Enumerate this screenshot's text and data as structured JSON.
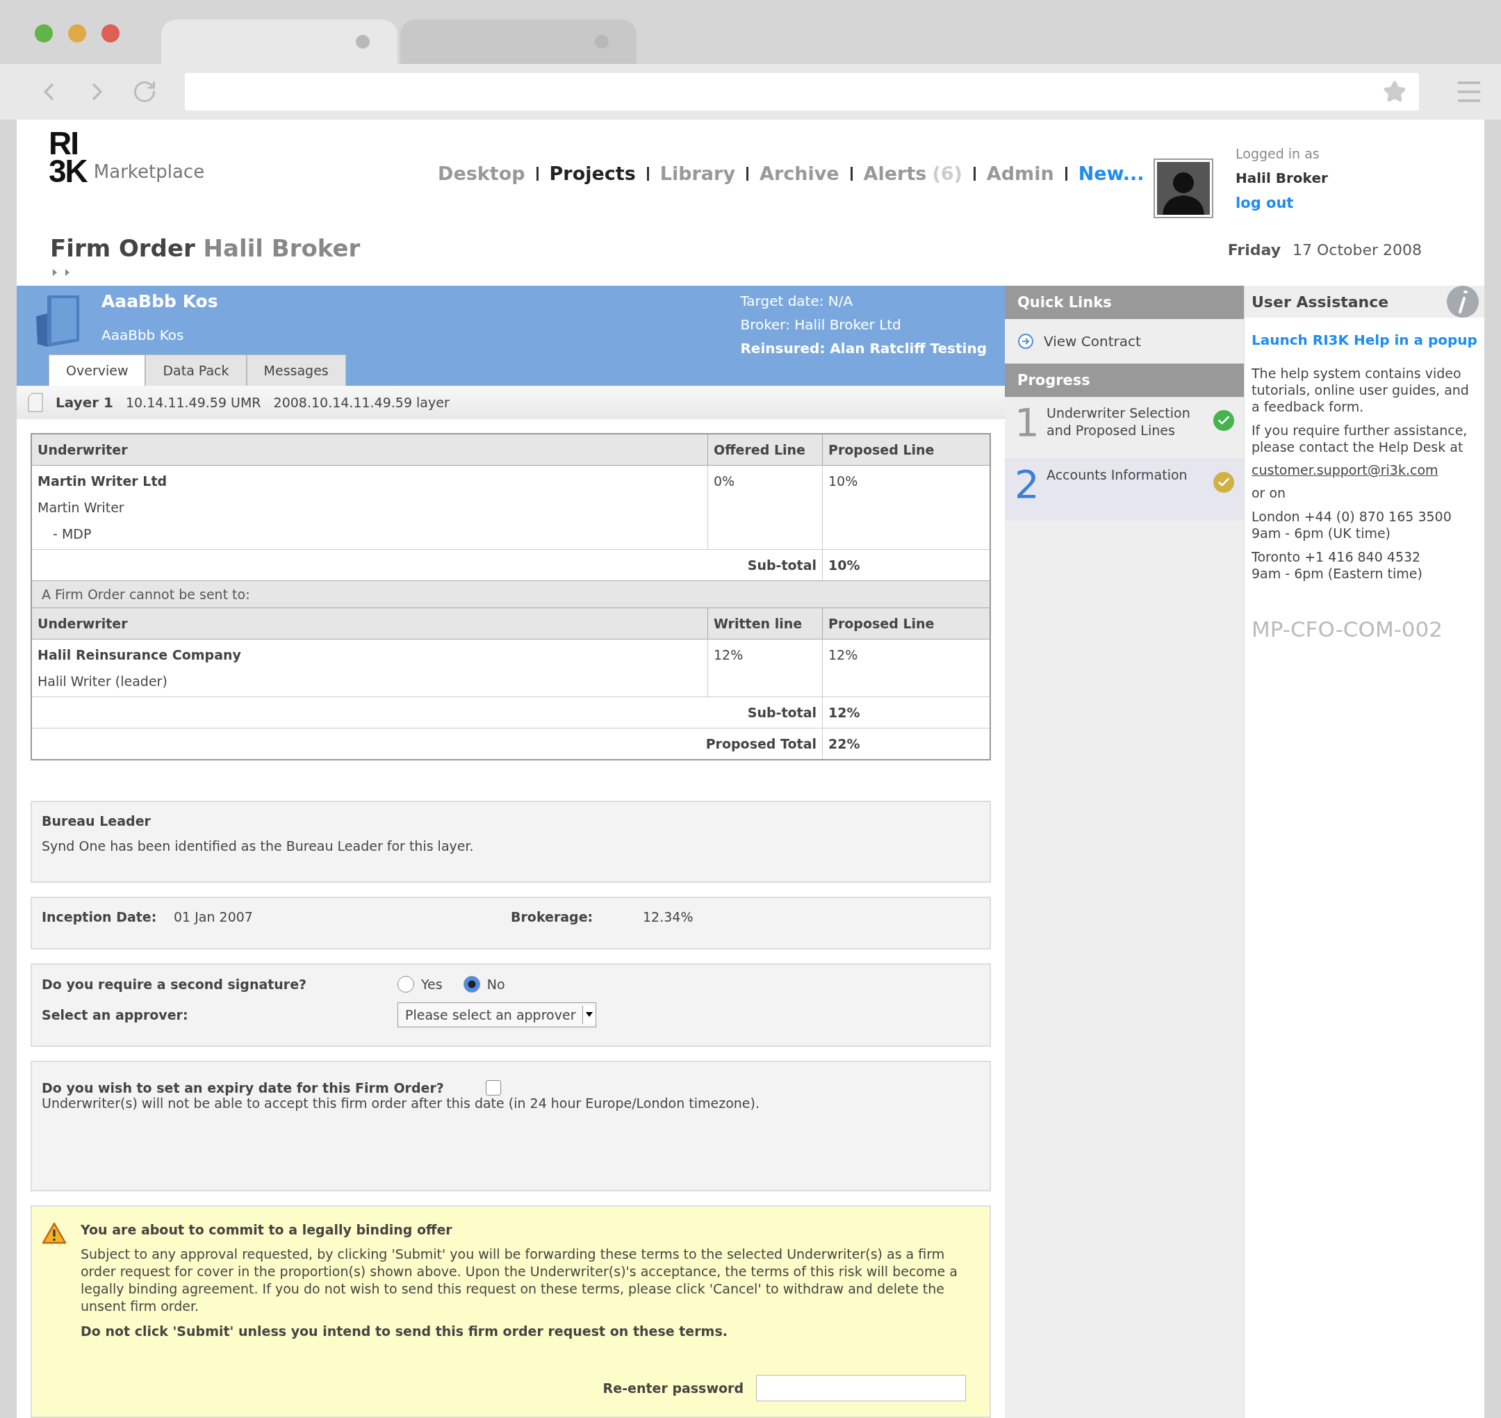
{
  "browser": {
    "tabs": [
      {
        "selected": true
      },
      {
        "selected": false
      }
    ]
  },
  "header": {
    "logo_top": "RI",
    "logo_bottom": "3K",
    "logo_sub": "Marketplace",
    "nav": [
      {
        "label": "Desktop",
        "kind": "link",
        "selected": false
      },
      {
        "label": "Projects",
        "kind": "link",
        "selected": true
      },
      {
        "label": "Library",
        "kind": "link",
        "selected": false
      },
      {
        "label": "Archive",
        "kind": "link",
        "selected": false
      },
      {
        "label": "Alerts",
        "count": "(6)",
        "kind": "link",
        "selected": false
      },
      {
        "label": "Admin",
        "kind": "link",
        "selected": false
      },
      {
        "label": "New...",
        "kind": "new",
        "selected": false
      }
    ],
    "user": {
      "caption": "Logged in as",
      "name": "Halil Broker",
      "logout": "log out"
    }
  },
  "page_title": {
    "main": "Firm Order",
    "sub": "Halil Broker"
  },
  "date": {
    "day": "Friday",
    "date": "17 October 2008"
  },
  "project": {
    "title": "AaaBbb Kos",
    "subtitle": "AaaBbb Kos",
    "meta": [
      "Target date: N/A",
      "Broker: Halil Broker Ltd"
    ],
    "reinsured": "Reinsured: Alan Ratcliff Testing",
    "tabs": [
      {
        "label": "Overview",
        "selected": true
      },
      {
        "label": "Data Pack",
        "selected": false
      },
      {
        "label": "Messages",
        "selected": false
      }
    ]
  },
  "layer": {
    "name": "Layer 1",
    "umr": "10.14.11.49.59 UMR",
    "ref": "2008.10.14.11.49.59 layer"
  },
  "table": {
    "columns": [
      "Underwriter",
      "Offered Line",
      "Proposed Line"
    ],
    "rows": [
      {
        "name": "Martin Writer Ltd",
        "lines": [
          "Martin Writer",
          "- MDP"
        ],
        "line": "0%",
        "proposed": "10%"
      }
    ],
    "subtotal": {
      "label": "Sub-total",
      "value": "10%"
    },
    "excluded_note": "A Firm Order cannot be sent to:",
    "excluded_columns": [
      "Underwriter",
      "Written line",
      "Proposed Line"
    ],
    "excluded_rows": [
      {
        "name": "Halil Reinsurance Company",
        "lines": [
          "Halil Writer (leader)"
        ],
        "line": "12%",
        "proposed": "12%"
      }
    ],
    "excluded_subtotal": {
      "label": "Sub-total",
      "value": "12%"
    },
    "total": {
      "label": "Proposed Total",
      "value": "22%"
    }
  },
  "bureau": {
    "title": "Bureau Leader",
    "text": "Synd One has been identified as the Bureau Leader for this layer."
  },
  "terms": [
    {
      "label": "Inception Date:",
      "value": "01 Jan 2007"
    },
    {
      "label": "Brokerage:",
      "value": "12.34%"
    }
  ],
  "signature": {
    "question": "Do you require a second signature?",
    "options": [
      {
        "label": "Yes",
        "selected": false
      },
      {
        "label": "No",
        "selected": true
      }
    ],
    "approver_label": "Select an approver:",
    "approver_value": "Please select an approver"
  },
  "expiry": {
    "question": "Do you wish to set an expiry date for this Firm Order?",
    "checked": false,
    "note": "Underwriter(s) will not be able to accept this firm order after this date (in 24 hour Europe/London timezone)."
  },
  "warning": {
    "title": "You are about to commit to a legally binding offer",
    "text": "Subject to any approval requested, by clicking 'Submit' you will be forwarding these terms to the selected Underwriter(s) as a firm order request for cover in the proportion(s) shown above. Upon the Underwriter(s)'s acceptance, the terms of this risk will become a legally binding agreement. If you do not wish to send this request on these terms, please click 'Cancel' to withdraw and delete the unsent firm order.",
    "emphasis": "Do not click 'Submit' unless you intend to send this firm order request on these terms.",
    "password_label": "Re-enter password"
  },
  "quick_links": {
    "title": "Quick Links",
    "items": [
      "View Contract"
    ]
  },
  "progress": {
    "title": "Progress",
    "steps": [
      {
        "number": "1",
        "label": "Underwriter Selection and Proposed Lines",
        "selected": false,
        "color": "#45b34e"
      },
      {
        "number": "2",
        "label": "Accounts Information",
        "selected": true,
        "color": "#d2b042"
      }
    ]
  },
  "assistance": {
    "title": "User Assistance",
    "link": "Launch RI3K Help in a popup",
    "paragraphs": [
      "The help system contains video tutorials, online user guides, and a feedback form.",
      "If you require further assistance, please contact the Help Desk at"
    ],
    "email": "customer.support@ri3k.com",
    "or": "or on",
    "contacts": [
      [
        "London +44 (0) 870 165 3500",
        "9am - 6pm (UK time)"
      ],
      [
        "Toronto +1 416 840 4532",
        "9am - 6pm (Eastern time)"
      ]
    ],
    "code": "MP-CFO-COM-002"
  }
}
